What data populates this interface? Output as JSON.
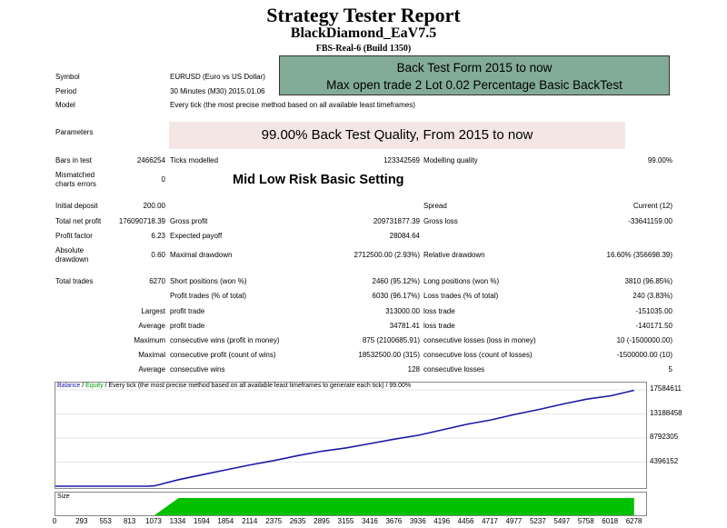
{
  "header": {
    "title": "Strategy Tester Report",
    "ea_name": "BlackDiamond_EaV7.5",
    "server": "FBS-Real-6 (Build 1350)"
  },
  "banner": {
    "line1": "Back Test Form 2015 to now",
    "line2": "Max open trade 2 Lot 0.02 Percentage Basic BackTest",
    "color": "#82ab98"
  },
  "info": {
    "symbol_label": "Symbol",
    "symbol_value": "EURUSD (Euro vs US Dollar)",
    "period_label": "Period",
    "period_value": "30 Minutes (M30) 2015.01.06",
    "model_label": "Model",
    "model_value": "Every tick (the most precise method based on all available least timeframes)",
    "parameters_label": "Parameters",
    "quality_banner": "99.00% Back Test Quality, From 2015 to now",
    "quality_color": "#f3e6e4"
  },
  "stats": {
    "bars_label": "Bars in test",
    "bars_value": "2466254",
    "ticks_label": "Ticks modelled",
    "ticks_value": "123342569",
    "mq_label": "Modelling quality",
    "mq_value": "99.00%",
    "mismatch_label1": "Mismatched",
    "mismatch_label2": "charts errors",
    "mismatch_value": "0",
    "risk_note": "Mid Low Risk Basic Setting",
    "deposit_label": "Initial deposit",
    "deposit_value": "200.00",
    "spread_label": "Spread",
    "spread_value": "Current (12)",
    "netprofit_label": "Total net profit",
    "netprofit_value": "176090718.39",
    "grossprofit_label": "Gross profit",
    "grossprofit_value": "209731877.39",
    "grossloss_label": "Gross loss",
    "grossloss_value": "-33641159.00",
    "pf_label": "Profit factor",
    "pf_value": "6.23",
    "ep_label": "Expected payoff",
    "ep_value": "28084.64",
    "absdd_label1": "Absolute",
    "absdd_label2": "drawdown",
    "absdd_value": "0.60",
    "maxdd_label": "Maximal drawdown",
    "maxdd_value": "2712500.00 (2.93%)",
    "reldd_label": "Relative drawdown",
    "reldd_value": "16.60% (356698.39)",
    "trades_label": "Total trades",
    "trades_value": "6270",
    "short_label": "Short positions (won %)",
    "short_value": "2460 (95.12%)",
    "long_label": "Long positions (won %)",
    "long_value": "3810 (96.85%)",
    "ptrades_label": "Profit trades (% of total)",
    "ptrades_value": "6030 (96.17%)",
    "ltrades_label": "Loss trades (% of total)",
    "ltrades_value": "240 (3.83%)",
    "largest_label": "Largest",
    "largest_p_label": "profit trade",
    "largest_p_value": "313000.00",
    "largest_l_label": "loss trade",
    "largest_l_value": "-151035.00",
    "average_label": "Average",
    "average_p_label": "profit trade",
    "average_p_value": "34781.41",
    "average_l_label": "loss trade",
    "average_l_value": "-140171.50",
    "maximum_label": "Maximum",
    "maxcw_label": "consecutive wins (profit in money)",
    "maxcw_value": "875 (2100685.91)",
    "maxcl_label": "consecutive losses (loss in money)",
    "maxcl_value": "10 (-1500000.00)",
    "maximal_label": "Maximal",
    "mcp_label": "consecutive profit (count of wins)",
    "mcp_value": "18532500.00 (315)",
    "mcl_label": "consecutive loss (count of losses)",
    "mcl_value": "-1500000.00 (10)",
    "avgc_label": "Average",
    "avgcw_label": "consecutive wins",
    "avgcw_value": "128",
    "avgcl_label": "consecutive losses",
    "avgcl_value": "5"
  },
  "chart_legend": {
    "balance": "Balance",
    "sep1": " / ",
    "equity": "Equity",
    "rest": " / Every tick (the most precise method based on all available least timeframes to generate each tick) / 99.00%",
    "balance_color": "#1a1aa6",
    "equity_color": "#00a000"
  },
  "chart_data": {
    "type": "line",
    "title": "",
    "xlabel": "",
    "ylabel": "",
    "x_ticks": [
      "0",
      "293",
      "553",
      "813",
      "1073",
      "1334",
      "1594",
      "1854",
      "2114",
      "2375",
      "2635",
      "2895",
      "3155",
      "3416",
      "3676",
      "3936",
      "4196",
      "4456",
      "4717",
      "4977",
      "5237",
      "5497",
      "5758",
      "6018",
      "6278"
    ],
    "y_ticks": [
      "17584611",
      "13188458",
      "8792305",
      "4396152"
    ],
    "ylim": [
      0,
      17584611
    ],
    "xlim": [
      0,
      6400
    ],
    "series": [
      {
        "name": "Balance",
        "x": [
          0,
          293,
          553,
          813,
          1000,
          1073,
          1334,
          1594,
          1854,
          2114,
          2375,
          2635,
          2895,
          3155,
          3416,
          3676,
          3936,
          4196,
          4456,
          4717,
          4977,
          5237,
          5497,
          5758,
          6018,
          6270
        ],
        "y": [
          200,
          200,
          200,
          200,
          5000,
          60000,
          1200000,
          2100000,
          3000000,
          3900000,
          4700000,
          5600000,
          6400000,
          7000000,
          7800000,
          8600000,
          9300000,
          10300000,
          11300000,
          12100000,
          13100000,
          14000000,
          15000000,
          15900000,
          16500000,
          17500000
        ]
      }
    ],
    "size_panel": {
      "label": "Size",
      "start_trade": 1073,
      "ramp_end_trade": 1334,
      "end_trade": 6270,
      "fill_color": "#00c000"
    }
  }
}
